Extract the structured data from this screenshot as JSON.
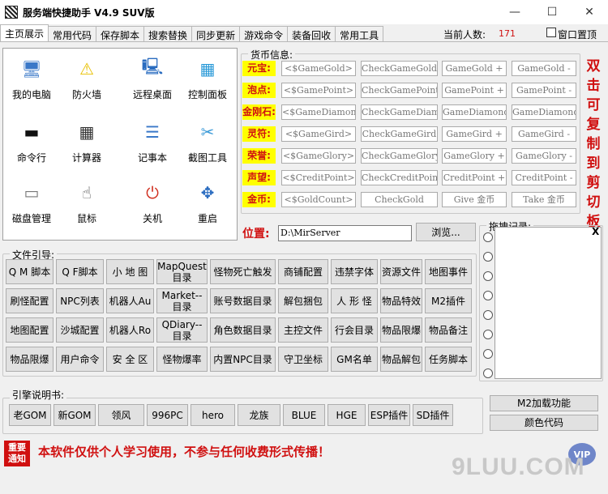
{
  "window": {
    "title": "服务端快捷助手 V4.9 SUV版",
    "minimize": "—",
    "maximize": "☐",
    "close": "✕"
  },
  "tabs": [
    "主页展示",
    "常用代码",
    "保存脚本",
    "搜索替换",
    "同步更新",
    "游戏命令",
    "装备回收",
    "常用工具"
  ],
  "status": {
    "online_label": "当前人数:",
    "online_count": "171",
    "on_top_label": "窗口置顶"
  },
  "desktop_icons": [
    {
      "label": "我的电脑",
      "icon": "computer-icon",
      "glyph": "🖥"
    },
    {
      "label": "防火墙",
      "icon": "shield-icon",
      "glyph": "⚠"
    },
    {
      "label": "远程桌面",
      "icon": "remote-desktop-icon",
      "glyph": "🖳"
    },
    {
      "label": "控制面板",
      "icon": "control-panel-icon",
      "glyph": "▦"
    },
    {
      "label": "命令行",
      "icon": "terminal-icon",
      "glyph": "▬"
    },
    {
      "label": "计算器",
      "icon": "calculator-icon",
      "glyph": "▦"
    },
    {
      "label": "记事本",
      "icon": "notepad-icon",
      "glyph": "☰"
    },
    {
      "label": "截图工具",
      "icon": "scissors-icon",
      "glyph": "✂"
    },
    {
      "label": "磁盘管理",
      "icon": "disk-icon",
      "glyph": "▭"
    },
    {
      "label": "鼠标",
      "icon": "mouse-icon",
      "glyph": "☝"
    },
    {
      "label": "关机",
      "icon": "power-icon",
      "glyph": "⏻"
    },
    {
      "label": "重启",
      "icon": "restart-icon",
      "glyph": "✥"
    }
  ],
  "currency": {
    "legend": "货币信息:",
    "rows": [
      {
        "label": "元宝:",
        "cells": [
          "<$GameGold>",
          "CheckGameGold",
          "GameGold +",
          "GameGold -"
        ]
      },
      {
        "label": "泡点:",
        "cells": [
          "<$GamePoint>",
          "CheckGamePoint",
          "GamePoint +",
          "GamePoint -"
        ]
      },
      {
        "label": "金刚石:",
        "cells": [
          "<$GameDiamond>",
          "CheckGameDiamond",
          "GameDiamond +",
          "GameDiamond -"
        ]
      },
      {
        "label": "灵符:",
        "cells": [
          "<$GameGird>",
          "CheckGameGird",
          "GameGird +",
          "GameGird -"
        ]
      },
      {
        "label": "荣誉:",
        "cells": [
          "<$GameGlory>",
          "CheckGameGlory",
          "GameGlory +",
          "GameGlory -"
        ]
      },
      {
        "label": "声望:",
        "cells": [
          "<$CreditPoint>",
          "CheckCreditPoint",
          "CreditPoint +",
          "CreditPoint -"
        ]
      },
      {
        "label": "金币:",
        "cells": [
          "<$GoldCount>",
          "CheckGold",
          "Give 金币",
          "Take 金币"
        ]
      }
    ],
    "side_note": [
      "双",
      "击",
      "可",
      "复",
      "制",
      "到",
      "剪",
      "切",
      "板"
    ]
  },
  "location": {
    "label": "位置:",
    "value": "D:\\MirServer",
    "browse": "浏览..."
  },
  "drag_log": {
    "legend": "拖拽记录:",
    "close": "X"
  },
  "file_guide": {
    "legend": "文件引导:",
    "rows": [
      [
        "Q M 脚本",
        "Q F脚本",
        "小 地 图",
        "MapQuest\n目录",
        "怪物死亡触发",
        "商铺配置",
        "违禁字体",
        "资源文件",
        "地图事件"
      ],
      [
        "刷怪配置",
        "NPC列表",
        "机器人Au",
        "Market--\n目录",
        "账号数据目录",
        "解包捆包",
        "人 形 怪",
        "物品特效",
        "M2插件"
      ],
      [
        "地图配置",
        "沙城配置",
        "机器人Ro",
        "QDiary--\n目录",
        "角色数据目录",
        "主控文件",
        "行会目录",
        "物品限爆",
        "物品备注"
      ],
      [
        "物品限爆",
        "用户命令",
        "安 全 区",
        "怪物爆率",
        "内置NPC目录",
        "守卫坐标",
        "GM名单",
        "物品解包",
        "任务脚本"
      ]
    ]
  },
  "engine": {
    "legend": "引擎说明书:",
    "items": [
      "老GOM",
      "新GOM",
      "领风",
      "996PC",
      "hero",
      "龙族",
      "BLUE",
      "HGE",
      "ESP插件",
      "SD插件"
    ],
    "m2_button": "M2加载功能",
    "color_button": "颜色代码"
  },
  "notice": {
    "badge_line1": "重要",
    "badge_line2": "通知",
    "text": "本软件仅供个人学习使用，不参与任何收费形式传播！"
  },
  "watermark": {
    "vip": "VIP",
    "site": "9LUU.COM"
  }
}
